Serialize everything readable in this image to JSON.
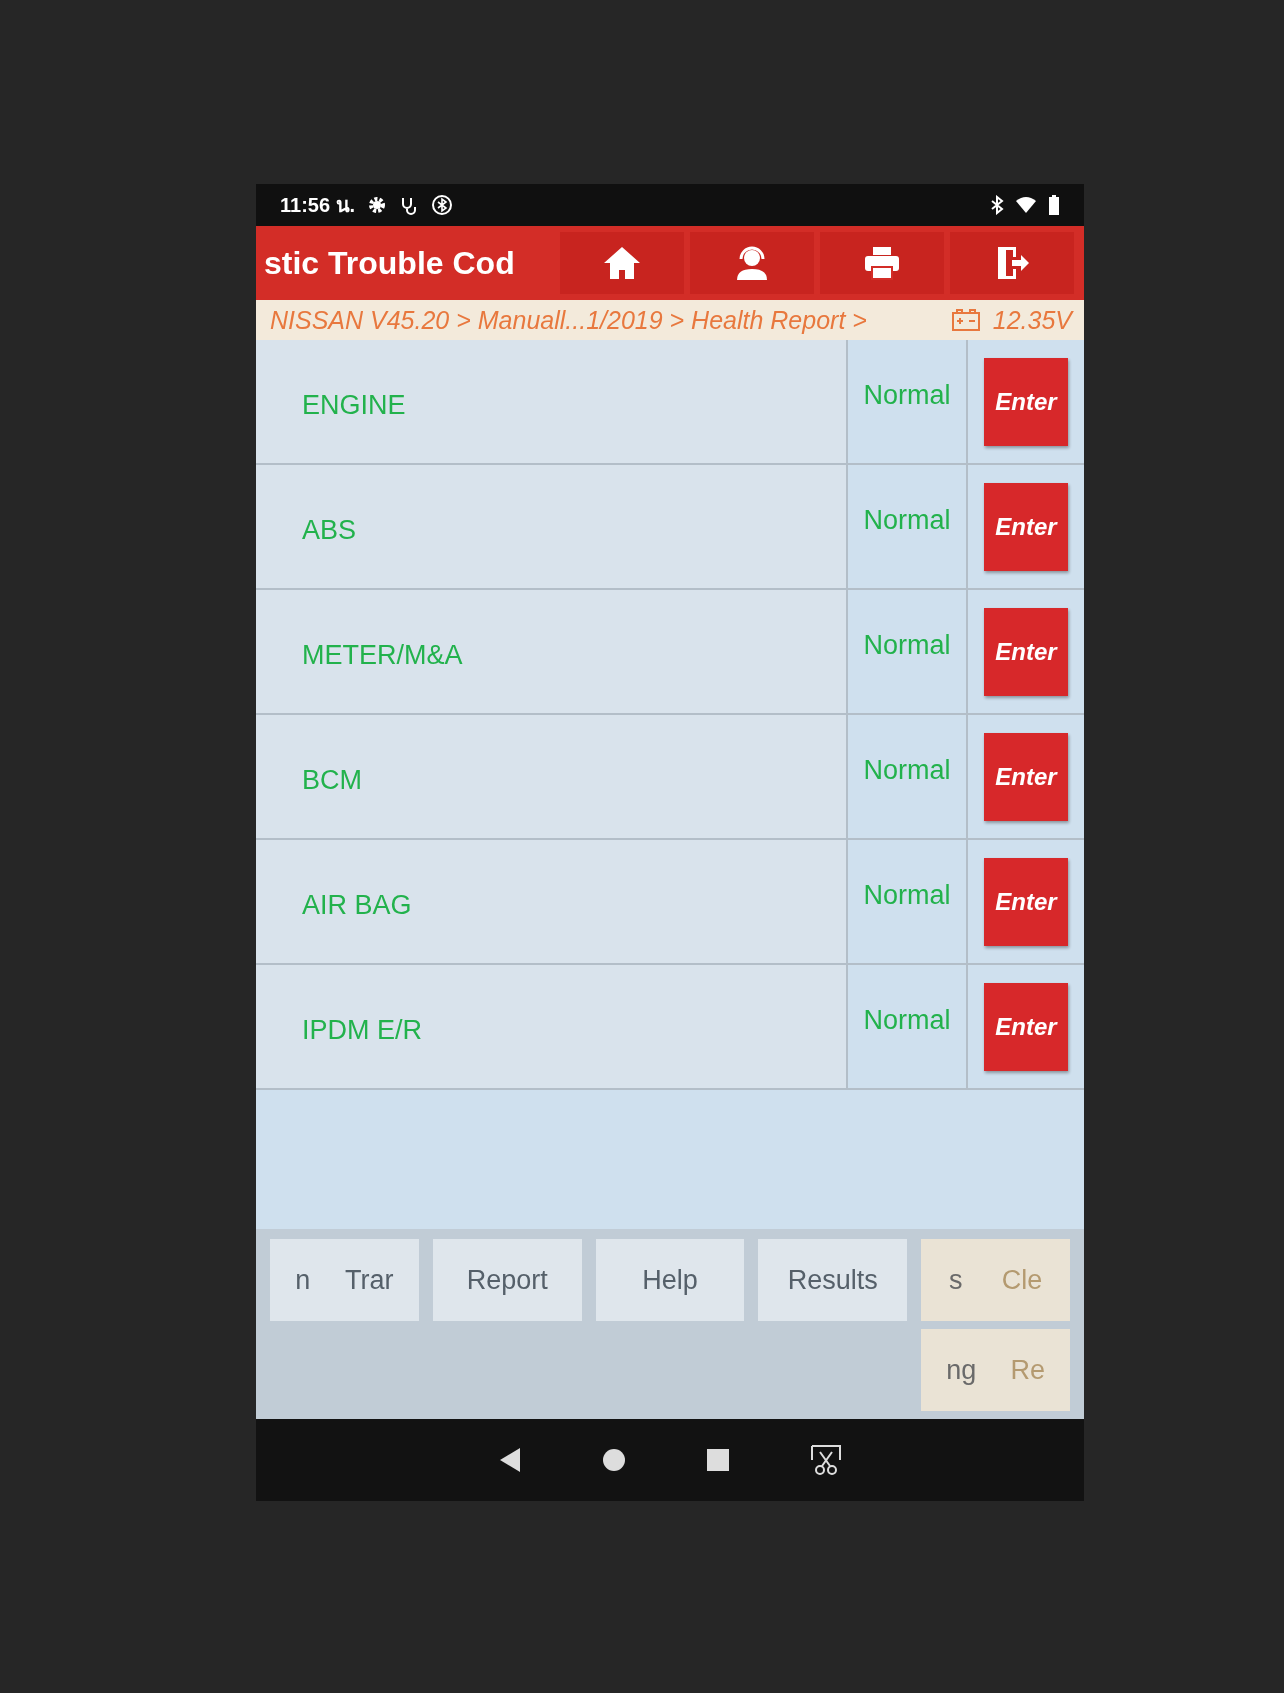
{
  "status_bar": {
    "time": "11:56 น."
  },
  "header": {
    "title": "stic Trouble Cod"
  },
  "breadcrumb": {
    "path": "NISSAN V45.20 > Manuall...1/2019 > Health Report >",
    "voltage": "12.35V"
  },
  "systems": [
    {
      "name": "ENGINE",
      "status": "Normal",
      "button": "Enter"
    },
    {
      "name": "ABS",
      "status": "Normal",
      "button": "Enter"
    },
    {
      "name": "METER/M&A",
      "status": "Normal",
      "button": "Enter"
    },
    {
      "name": "BCM",
      "status": "Normal",
      "button": "Enter"
    },
    {
      "name": "AIR BAG",
      "status": "Normal",
      "button": "Enter"
    },
    {
      "name": "IPDM E/R",
      "status": "Normal",
      "button": "Enter"
    }
  ],
  "buttons": [
    {
      "labels": [
        "n",
        "Trar"
      ]
    },
    {
      "labels": [
        "Report"
      ]
    },
    {
      "labels": [
        "Help"
      ]
    },
    {
      "labels": [
        "Results"
      ]
    },
    {
      "labels": [
        "s",
        "Cle"
      ]
    },
    {
      "labels": [
        "ng",
        "Re"
      ]
    }
  ]
}
